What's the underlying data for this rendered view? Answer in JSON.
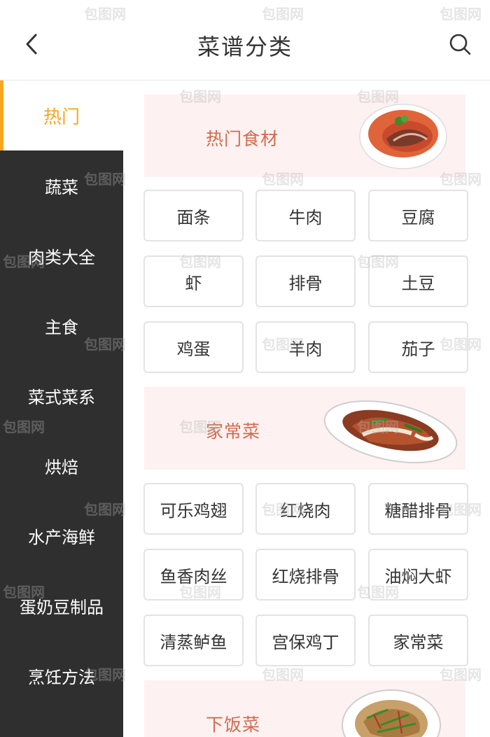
{
  "header": {
    "title": "菜谱分类"
  },
  "sidebar": {
    "active": "热门",
    "items": [
      "蔬菜",
      "肉类大全",
      "主食",
      "菜式菜系",
      "烘焙",
      "水产海鲜",
      "蛋奶豆制品",
      "烹饪方法"
    ]
  },
  "sections": [
    {
      "title": "热门食材",
      "items": [
        "面条",
        "牛肉",
        "豆腐",
        "虾",
        "排骨",
        "土豆",
        "鸡蛋",
        "羊肉",
        "茄子"
      ]
    },
    {
      "title": "家常菜",
      "items": [
        "可乐鸡翅",
        "红烧肉",
        "糖醋排骨",
        "鱼香肉丝",
        "红烧排骨",
        "油焖大虾",
        "清蒸鲈鱼",
        "宫保鸡丁",
        "家常菜"
      ]
    },
    {
      "title": "下饭菜",
      "items": []
    }
  ],
  "watermark": "包图网",
  "colors": {
    "accent": "#f5a623",
    "sidebar": "#2f2f2f",
    "banner": "#fdf1f1",
    "banner_text": "#cf6b4f"
  }
}
